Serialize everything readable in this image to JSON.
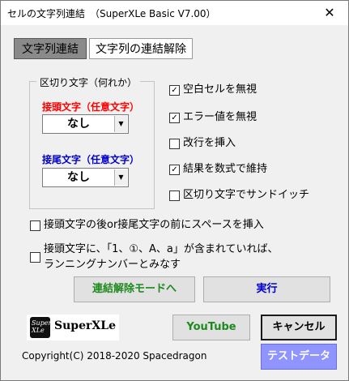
{
  "window": {
    "title": "セルの文字列連結　（SuperXLe Basic V7.00）",
    "close_label": "✕"
  },
  "tabs": [
    {
      "label": "文字列連結",
      "active": true
    },
    {
      "label": "文字列の連結解除",
      "active": false
    }
  ],
  "delimiter_group": {
    "legend": "区切り文字（何れか）",
    "prefix_label": "接頭文字（任意文字）",
    "prefix_value": "なし",
    "suffix_label": "接尾文字（任意文字）",
    "suffix_value": "なし"
  },
  "options": {
    "ignore_blank": {
      "label": "空白セルを無視",
      "checked": true
    },
    "ignore_error": {
      "label": "エラー値を無視",
      "checked": true
    },
    "insert_newline": {
      "label": "改行を挿入",
      "checked": false
    },
    "keep_formula": {
      "label": "結果を数式で維持",
      "checked": true
    },
    "sandwich": {
      "label": "区切り文字でサンドイッチ",
      "checked": false
    },
    "insert_space": {
      "label": "接頭文字の後or接尾文字の前にスペースを挿入",
      "checked": false
    },
    "running_number": {
      "label_line1": "接頭文字に、「1、①、A、a」が含まれていれば、",
      "label_line2": "ランニングナンバーとみなす",
      "checked": false
    }
  },
  "buttons": {
    "switch_mode": "連結解除モードへ",
    "execute": "実行",
    "youtube": "YouTube",
    "cancel": "キャンセル",
    "test_data": "テストデータ"
  },
  "logo": {
    "icon_text": "Super XLe",
    "text": "SuperXLe"
  },
  "footer": {
    "copyright": "Copyright(C) 2018-2020 Spacedragon"
  },
  "colors": {
    "prefix_label": "#ff0000",
    "suffix_label": "#0000cc",
    "button_text_green": "#1e8a1e",
    "button_text_blue": "#0000cc",
    "test_data_bg": "#8f94ff",
    "active_tab_bg": "#8a8a8a"
  }
}
